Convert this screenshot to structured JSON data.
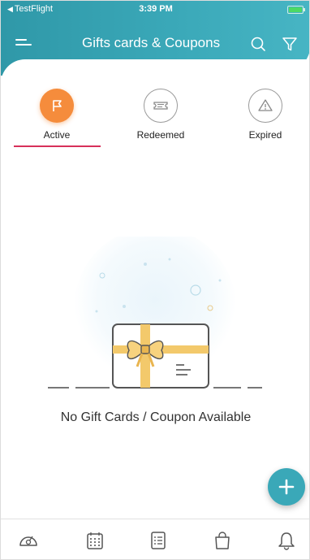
{
  "status_bar": {
    "back_app": "TestFlight",
    "time": "3:39 PM"
  },
  "header": {
    "title": "Gifts cards & Coupons",
    "icons": [
      "menu-icon",
      "search-icon",
      "filter-icon"
    ]
  },
  "tabs": [
    {
      "label": "Active",
      "icon": "flag-icon",
      "selected": true
    },
    {
      "label": "Redeemed",
      "icon": "ticket-icon",
      "selected": false
    },
    {
      "label": "Expired",
      "icon": "warning-icon",
      "selected": false
    }
  ],
  "empty_state": {
    "message": "No Gift Cards / Coupon Available",
    "illustration": "gift-card-illustration"
  },
  "fab": {
    "icon": "plus-icon"
  },
  "bottom_nav": {
    "items": [
      "dashboard-icon",
      "calendar-icon",
      "checklist-icon",
      "shopping-bag-icon",
      "bell-icon"
    ]
  },
  "colors": {
    "header": "#3aa8b8",
    "active_tab": "#f58c3c",
    "tab_underline": "#d7305a",
    "fab": "#3aa8b8"
  }
}
